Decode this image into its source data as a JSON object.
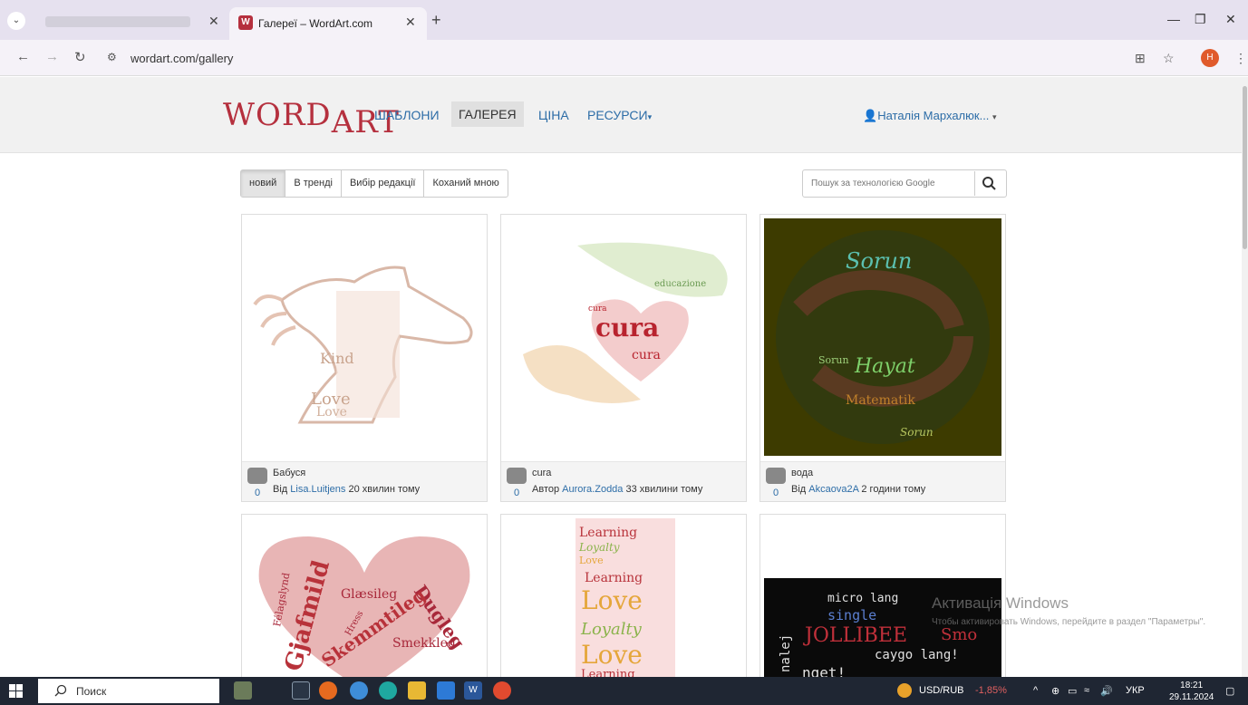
{
  "browser": {
    "tab_active_title": "Галереї – WordArt.com",
    "tab_favicon": "W",
    "url": "wordart.com/gallery"
  },
  "site": {
    "logo_left": "WORD",
    "logo_right": "ART",
    "nav": [
      {
        "label": "ШАБЛОНИ"
      },
      {
        "label": "ГАЛЕРЕЯ"
      },
      {
        "label": "ЦІНА"
      },
      {
        "label": "РЕСУРСИ"
      }
    ],
    "user": "Наталія Мархалюк..."
  },
  "filters": [
    "новий",
    "В тренді",
    "Вибір редакції",
    "Коханий мною"
  ],
  "search": {
    "placeholder": "Пошук за технологією Google"
  },
  "cards": [
    {
      "title": "Бабуся",
      "prefix": "Від",
      "author": "Lisa.Luitjens",
      "time": "20 хвилин тому",
      "count": "0"
    },
    {
      "title": "cura",
      "prefix": "Автор",
      "author": "Aurora.Zodda",
      "time": "33 хвилини тому",
      "count": "0"
    },
    {
      "title": "вода",
      "prefix": "Від",
      "author": "Akcaova2A",
      "time": "2 години тому",
      "count": "0"
    }
  ],
  "art": {
    "horse": [
      "Kind",
      "Love",
      "Love"
    ],
    "cura": [
      "cura",
      "cura",
      "educazione",
      "cura"
    ],
    "crab": [
      "Sorun",
      "Hayat",
      "Matematik",
      "Sorun",
      "Sorun"
    ],
    "heart": [
      "Gjafmild",
      "Glæsileg",
      "Dugleg",
      "Skemmtileg",
      "Smekkleg",
      "Félagslynd",
      "Hress"
    ],
    "stack": [
      "Learning",
      "Loyalty",
      "Love",
      "Learning",
      "Love",
      "Loyalty",
      "Love",
      "Learning"
    ],
    "dark": [
      "micro lang",
      "single",
      "JOLLIBEE",
      "caygo lang!",
      "nget!",
      "nalej",
      "Smo"
    ]
  },
  "watermark": {
    "line1": "Активація Windows",
    "line2": "Чтобы активировать Windows, перейдите в раздел \"Параметры\"."
  },
  "taskbar": {
    "search": "Поиск",
    "currency": "USD/RUB",
    "change": "-1,85%",
    "lang": "УКР",
    "time": "18:21",
    "date": "29.11.2024"
  },
  "colors": {
    "brand": "#b5303e",
    "link": "#2d6da7",
    "negative": "#e06060"
  }
}
